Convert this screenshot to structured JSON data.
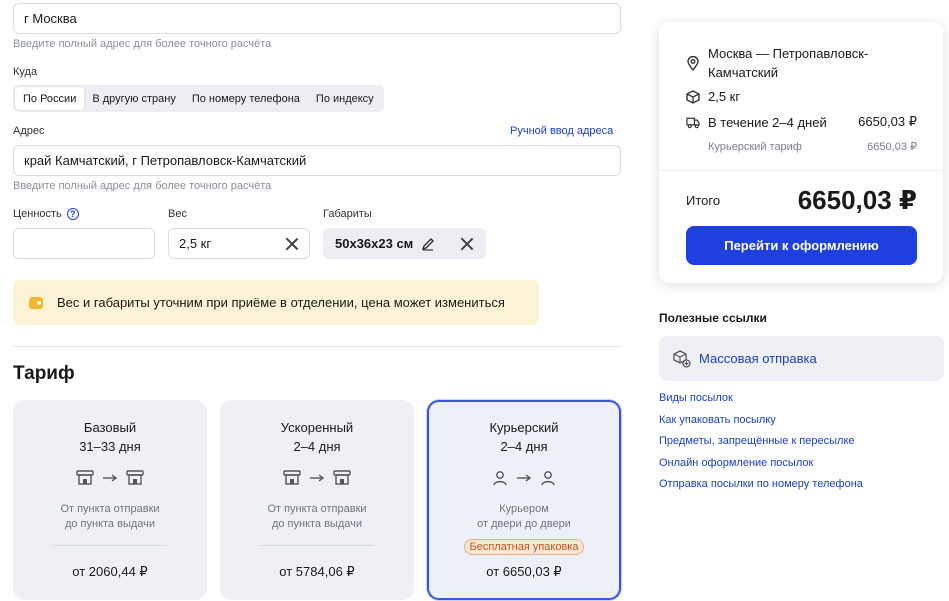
{
  "from": {
    "address_value": "г Москва",
    "hint": "Введите полный адрес для более точного расчёта"
  },
  "to": {
    "label": "Куда",
    "tabs": [
      "По России",
      "В другую страну",
      "По номеру телефона",
      "По индексу"
    ],
    "active_tab": "По России",
    "address_label": "Адрес",
    "manual_link": "Ручной ввод адреса",
    "address_value": "край Камчатский, г Петропавловск-Камчатский",
    "hint": "Введите полный адрес для более точного расчёта"
  },
  "params": {
    "value_label": "Ценность",
    "value_value": "",
    "weight_label": "Вес",
    "weight_value": "2,5 кг",
    "dims_label": "Габариты",
    "dims_value": "50x36x23 см"
  },
  "notice": "Вес и габариты уточним при приёме в отделении, цена может измениться",
  "tariff": {
    "title": "Тариф",
    "cards": [
      {
        "name": "Базовый",
        "days": "31–33 дня",
        "desc1": "От пункта отправки",
        "desc2": "до пункта выдачи",
        "price": "от 2060,44 ₽",
        "selected": false
      },
      {
        "name": "Ускоренный",
        "days": "2–4 дня",
        "desc1": "От пункта отправки",
        "desc2": "до пункта выдачи",
        "price": "от 5784,06 ₽",
        "selected": false
      },
      {
        "name": "Курьерский",
        "days": "2–4 дня",
        "desc1": "Курьером",
        "desc2": "от двери до двери",
        "badge": "Бесплатная упаковка",
        "price": "от 6650,03 ₽",
        "selected": true
      }
    ]
  },
  "summary": {
    "route_line1": "Москва — Петропавловск-",
    "route_line2": "Камчатский",
    "weight": "2,5 кг",
    "delivery": "В течение 2–4 дней",
    "delivery_price": "6650,03 ₽",
    "tariff_name": "Курьерский тариф",
    "tariff_price": "6650,03 ₽",
    "total_label": "Итого",
    "total_value": "6650,03 ₽",
    "checkout_button": "Перейти к оформлению"
  },
  "useful": {
    "title": "Полезные ссылки",
    "mass_send": "Массовая отправка",
    "links": [
      "Виды посылок",
      "Как упаковать посылку",
      "Предметы, запрещённые к пересылке",
      "Онлайн оформление посылок",
      "Отправка посылки по номеру телефона"
    ]
  },
  "colors": {
    "accent": "#1f3fe0",
    "link": "#1a3fbf",
    "notice_bg": "#fcf3d6",
    "badge": "#c0561b"
  }
}
